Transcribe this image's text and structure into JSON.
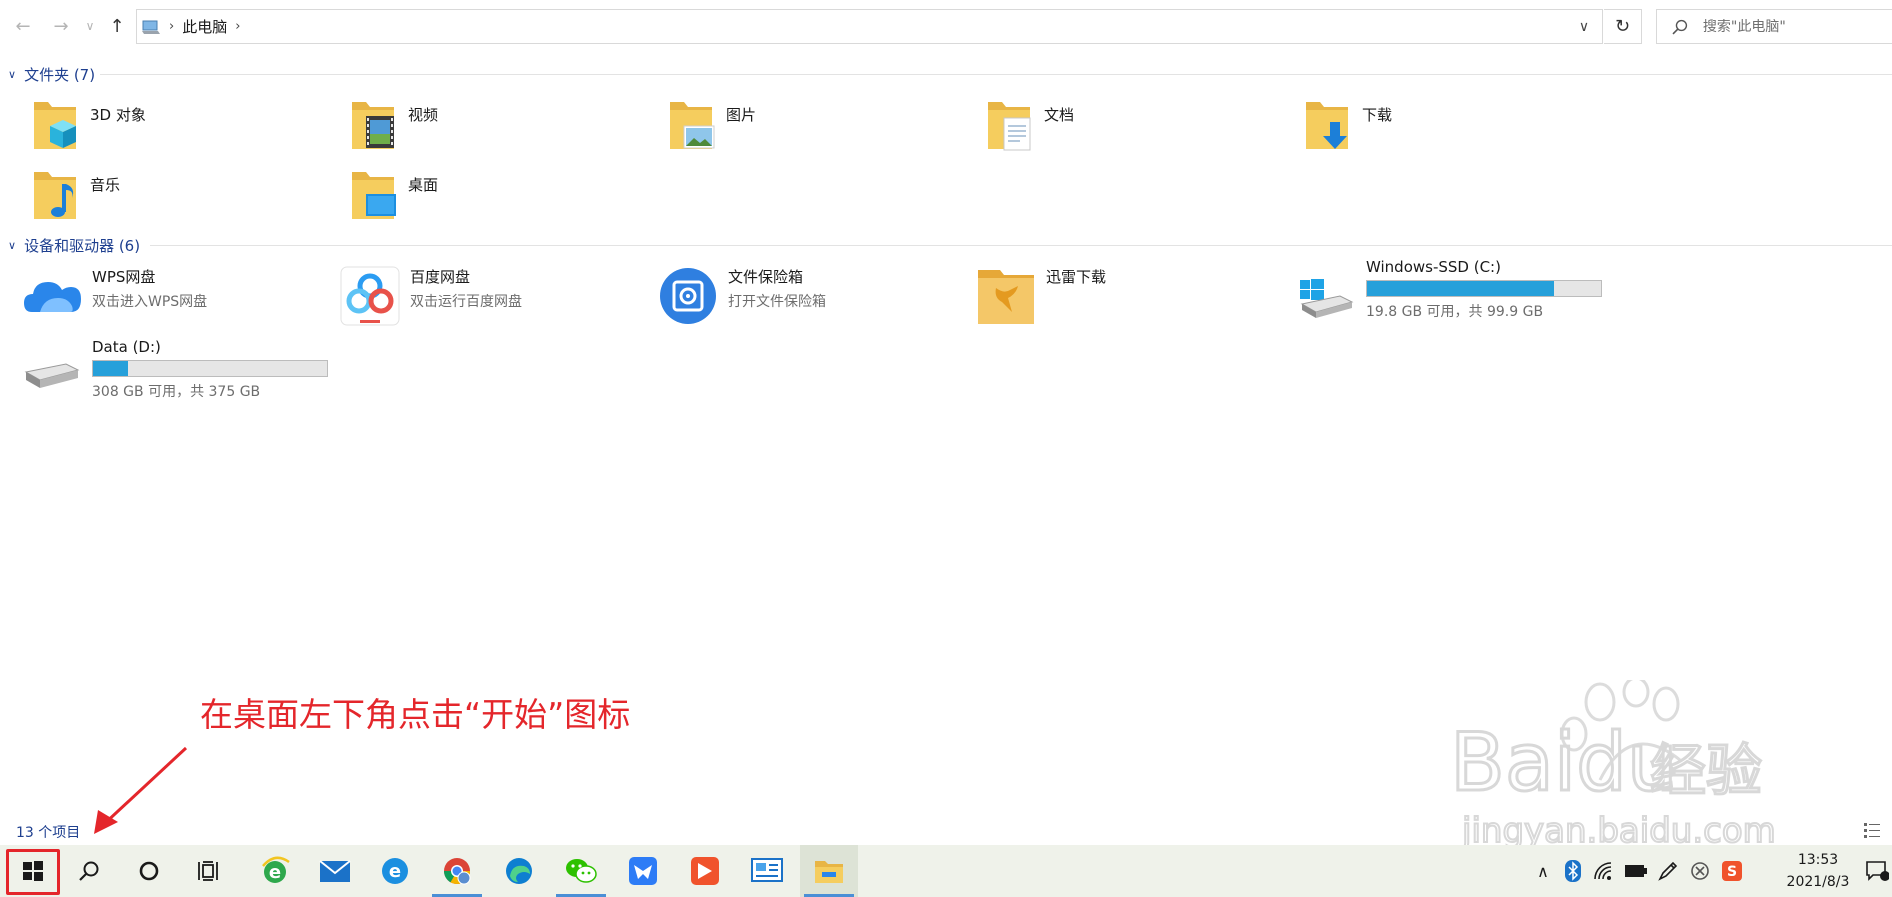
{
  "address": {
    "crumb": "此电脑",
    "search_placeholder": "搜索\"此电脑\""
  },
  "folders_section": {
    "title": "文件夹 (7)",
    "items": [
      {
        "label": "3D 对象",
        "icon": "3d-objects-folder-icon"
      },
      {
        "label": "视频",
        "icon": "videos-folder-icon"
      },
      {
        "label": "图片",
        "icon": "pictures-folder-icon"
      },
      {
        "label": "文档",
        "icon": "documents-folder-icon"
      },
      {
        "label": "下载",
        "icon": "downloads-folder-icon"
      },
      {
        "label": "音乐",
        "icon": "music-folder-icon"
      },
      {
        "label": "桌面",
        "icon": "desktop-folder-icon"
      }
    ]
  },
  "devices_section": {
    "title": "设备和驱动器 (6)",
    "items": [
      {
        "name": "WPS网盘",
        "sub": "双击进入WPS网盘",
        "icon": "wps-cloud-icon"
      },
      {
        "name": "百度网盘",
        "sub": "双击运行百度网盘",
        "icon": "baidu-netdisk-icon"
      },
      {
        "name": "文件保险箱",
        "sub": "打开文件保险箱",
        "icon": "file-safe-icon"
      },
      {
        "name": "迅雷下载",
        "icon": "thunder-download-icon"
      },
      {
        "name": "Windows-SSD (C:)",
        "sub": "19.8 GB 可用，共 99.9 GB",
        "icon": "windows-drive-icon",
        "used_fraction": 0.8
      },
      {
        "name": "Data (D:)",
        "sub": "308 GB 可用，共 375 GB",
        "icon": "hard-drive-icon",
        "used_fraction": 0.15
      }
    ]
  },
  "annotation": {
    "text": "在桌面左下角点击“开始”图标",
    "color": "#e4262b"
  },
  "status": {
    "item_count": "13 个项目"
  },
  "taskbar": {
    "clock_time": "13:53",
    "clock_date": "2021/8/3",
    "apps": [
      "windows-start-icon",
      "search-icon",
      "cortana-icon",
      "task-view-icon",
      "ie-icon",
      "mail-icon",
      "edge-legacy-icon",
      "chrome-icon",
      "edge-icon",
      "wechat-icon",
      "feishu-icon",
      "wps-office-icon",
      "control-panel-icon",
      "file-explorer-icon"
    ]
  },
  "colors": {
    "accent": "#26a0da",
    "link": "#1e3f8f",
    "folder": "#f5c85a"
  }
}
